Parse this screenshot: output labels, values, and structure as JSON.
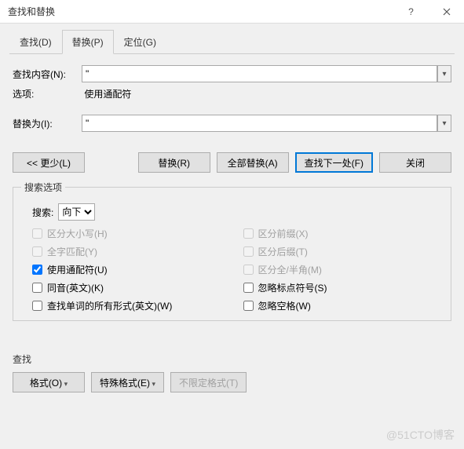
{
  "title": "查找和替换",
  "tabs": {
    "find": "查找(D)",
    "replace": "替换(P)",
    "goto": "定位(G)"
  },
  "labels": {
    "find_what": "查找内容(N):",
    "options": "选项:",
    "options_val": "使用通配符",
    "replace_with": "替换为(I):"
  },
  "inputs": {
    "find_value": "\"",
    "replace_value": "\""
  },
  "buttons": {
    "less": "<< 更少(L)",
    "replace": "替换(R)",
    "replace_all": "全部替换(A)",
    "find_next": "查找下一处(F)",
    "close": "关闭",
    "format": "格式(O)",
    "special": "特殊格式(E)",
    "noformat": "不限定格式(T)"
  },
  "search_options": {
    "legend": "搜索选项",
    "search_label": "搜索:",
    "direction": "向下",
    "match_case": "区分大小写(H)",
    "whole_word": "全字匹配(Y)",
    "wildcards": "使用通配符(U)",
    "sounds_like": "同音(英文)(K)",
    "all_forms": "查找单词的所有形式(英文)(W)",
    "match_prefix": "区分前缀(X)",
    "match_suffix": "区分后缀(T)",
    "full_half": "区分全/半角(M)",
    "ignore_punct": "忽略标点符号(S)",
    "ignore_space": "忽略空格(W)"
  },
  "find_section": "查找",
  "watermark": "@51CTO博客"
}
